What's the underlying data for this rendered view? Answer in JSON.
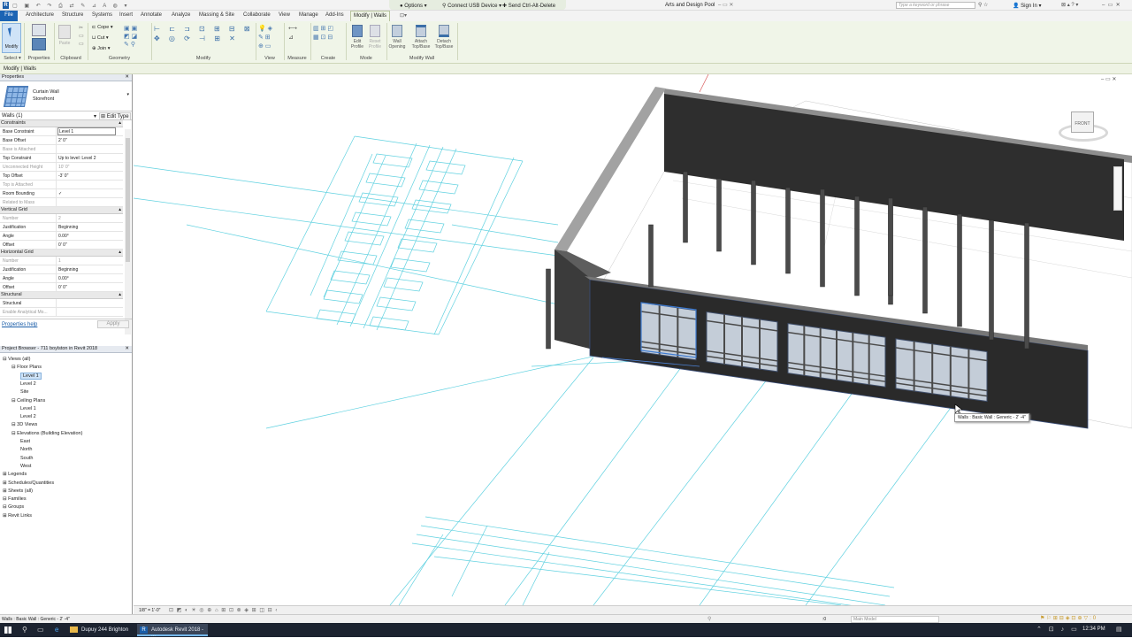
{
  "titlebar": {
    "window_title": "Arts and Design Pool",
    "options_label": "Options",
    "usb_label": "Connect USB Device",
    "cad_label": "Send Ctrl-Alt-Delete",
    "search_placeholder": "Type a keyword or phrase",
    "signin_label": "Sign In"
  },
  "ribbon_tabs": [
    "File",
    "Architecture",
    "Structure",
    "Systems",
    "Insert",
    "Annotate",
    "Analyze",
    "Massing & Site",
    "Collaborate",
    "View",
    "Manage",
    "Add-Ins",
    "Modify | Walls"
  ],
  "ribbon": {
    "modify_label": "Modify",
    "properties_label": "Properties",
    "paste_label": "Paste",
    "cope_label": "Cope",
    "cut_label": "Cut",
    "join_label": "Join",
    "edit_profile_label": "Edit\nProfile",
    "reset_profile_label": "Reset\nProfile",
    "wall_opening_label": "Wall\nOpening",
    "attach_label": "Attach\nTop/Base",
    "detach_label": "Detach\nTop/Base",
    "groups": [
      "Select ▾",
      "Properties",
      "Clipboard",
      "Geometry",
      "Modify",
      "View",
      "Measure",
      "Create",
      "Mode",
      "Modify Wall"
    ]
  },
  "context_bar": {
    "label": "Modify | Walls"
  },
  "properties": {
    "title": "Properties",
    "type_name": "Curtain Wall",
    "type_sub": "Storefront",
    "instance_filter": "Walls (1)",
    "edit_type": "Edit Type",
    "sections": [
      {
        "name": "Constraints",
        "rows": [
          {
            "k": "Base Constraint",
            "v": "Level 1"
          },
          {
            "k": "Base Offset",
            "v": "2'  0\""
          },
          {
            "k": "Base is Attached",
            "v": ""
          },
          {
            "k": "Top Constraint",
            "v": "Up to level: Level 2"
          },
          {
            "k": "Unconnected Height",
            "v": "10'  0\""
          },
          {
            "k": "Top Offset",
            "v": "-3'  0\""
          },
          {
            "k": "Top is Attached",
            "v": ""
          },
          {
            "k": "Room Bounding",
            "v": "✓"
          },
          {
            "k": "Related to Mass",
            "v": ""
          }
        ]
      },
      {
        "name": "Vertical Grid",
        "rows": [
          {
            "k": "Number",
            "v": "2"
          },
          {
            "k": "Justification",
            "v": "Beginning"
          },
          {
            "k": "Angle",
            "v": "0.00°"
          },
          {
            "k": "Offset",
            "v": "0'  0\""
          }
        ]
      },
      {
        "name": "Horizontal Grid",
        "rows": [
          {
            "k": "Number",
            "v": "1"
          },
          {
            "k": "Justification",
            "v": "Beginning"
          },
          {
            "k": "Angle",
            "v": "0.00°"
          },
          {
            "k": "Offset",
            "v": "0'  0\""
          }
        ]
      },
      {
        "name": "Structural",
        "rows": [
          {
            "k": "Structural",
            "v": ""
          },
          {
            "k": "Enable Analytical Mo...",
            "v": ""
          }
        ]
      }
    ],
    "help_link": "Properties help",
    "apply_label": "Apply"
  },
  "project_browser": {
    "title": "Project Browser - 711 boylston in Revit 2018",
    "items": [
      {
        "label": "Views (all)",
        "depth": 0
      },
      {
        "label": "Floor Plans",
        "depth": 1
      },
      {
        "label": "Level 1",
        "depth": 2
      },
      {
        "label": "Level 2",
        "depth": 2
      },
      {
        "label": "Site",
        "depth": 2
      },
      {
        "label": "Ceiling Plans",
        "depth": 1
      },
      {
        "label": "Level 1",
        "depth": 2
      },
      {
        "label": "Level 2",
        "depth": 2
      },
      {
        "label": "3D Views",
        "depth": 1
      },
      {
        "label": "Elevations (Building Elevation)",
        "depth": 1
      },
      {
        "label": "East",
        "depth": 2
      },
      {
        "label": "North",
        "depth": 2
      },
      {
        "label": "South",
        "depth": 2
      },
      {
        "label": "West",
        "depth": 2
      },
      {
        "label": "Legends",
        "depth": 0
      },
      {
        "label": "Schedules/Quantities",
        "depth": 0
      },
      {
        "label": "Sheets (all)",
        "depth": 0
      },
      {
        "label": "Families",
        "depth": 0
      },
      {
        "label": "Groups",
        "depth": 0
      },
      {
        "label": "Revit Links",
        "depth": 0
      }
    ]
  },
  "viewport": {
    "tooltip": "Walls : Basic Wall : Generic - 2' -4\"",
    "viewcube_label": "FRONT"
  },
  "view_bar": {
    "scale": "1/8\" = 1'-0\""
  },
  "status_bar": {
    "left_text": "Walls : Basic Wall : Generic - 2' -4\"",
    "model_label": "Main Model",
    "zoom": ":0"
  },
  "taskbar": {
    "items": [
      "Dupuy 244 Brighton",
      "Autodesk Revit 2018 - ..."
    ],
    "time": "12:34 PM"
  }
}
